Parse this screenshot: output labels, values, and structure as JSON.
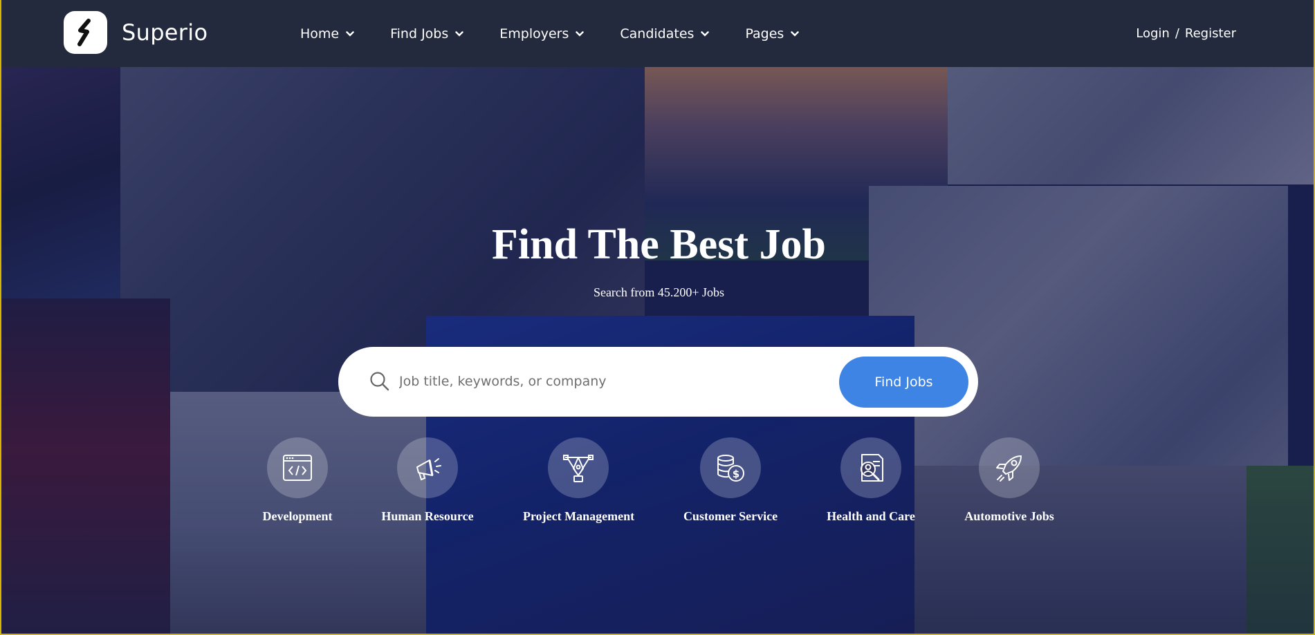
{
  "brand": {
    "name": "Superio"
  },
  "nav": {
    "items": [
      {
        "label": "Home"
      },
      {
        "label": "Find Jobs"
      },
      {
        "label": "Employers"
      },
      {
        "label": "Candidates"
      },
      {
        "label": "Pages"
      }
    ],
    "login_label": "Login",
    "separator": "/",
    "register_label": "Register"
  },
  "hero": {
    "title": "Find The Best Job",
    "subtitle": "Search from 45.200+ Jobs"
  },
  "search": {
    "placeholder": "Job title, keywords, or company",
    "value": "",
    "button_label": "Find Jobs"
  },
  "categories": [
    {
      "label": "Development",
      "icon": "code-window-icon"
    },
    {
      "label": "Human Resource",
      "icon": "megaphone-icon"
    },
    {
      "label": "Project Management",
      "icon": "pen-tool-icon"
    },
    {
      "label": "Customer Service",
      "icon": "coins-icon"
    },
    {
      "label": "Health and Care",
      "icon": "doctor-document-icon"
    },
    {
      "label": "Automotive Jobs",
      "icon": "rocket-icon"
    }
  ],
  "colors": {
    "header_bg": "#232a3d",
    "accent": "#3e84e4",
    "hero_overlay": "#141a4a"
  }
}
